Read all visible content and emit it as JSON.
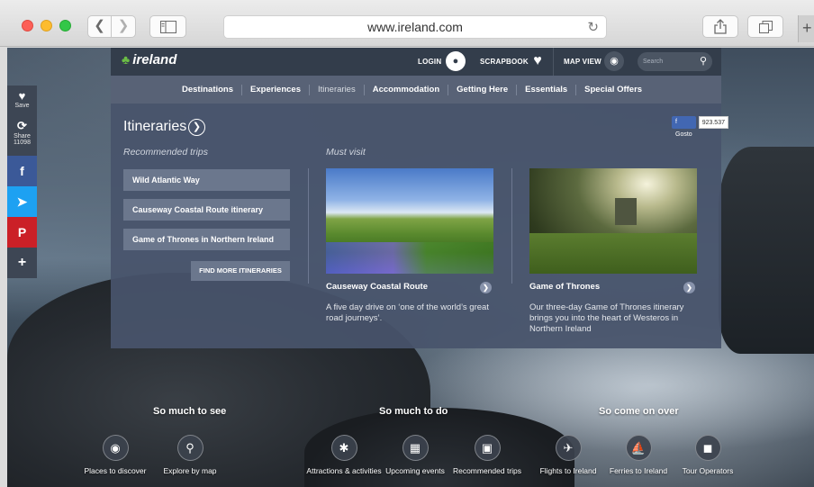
{
  "browser": {
    "url": "www.ireland.com",
    "back_icon": "chevron-left-icon",
    "forward_icon": "chevron-right-icon",
    "new_tab_glyph": "+"
  },
  "header": {
    "logo_text": "ireland",
    "login_label": "LOGIN",
    "scrapbook_label": "SCRAPBOOK",
    "map_view_label": "MAP VIEW",
    "search_placeholder": "Search"
  },
  "social": {
    "save_label": "Save",
    "share_label": "Share",
    "share_count": "11098",
    "facebook_glyph": "f",
    "twitter_glyph": "t",
    "pinterest_glyph": "P",
    "more_glyph": "+"
  },
  "nav": {
    "items": [
      {
        "label": "Destinations"
      },
      {
        "label": "Experiences"
      },
      {
        "label": "Itineraries"
      },
      {
        "label": "Accommodation"
      },
      {
        "label": "Getting Here"
      },
      {
        "label": "Essentials"
      },
      {
        "label": "Special Offers"
      }
    ]
  },
  "dropdown": {
    "title": "Itineraries",
    "facebook_like_label": "Gosto",
    "facebook_like_count": "923.537",
    "recommended_heading": "Recommended trips",
    "must_visit_heading": "Must visit",
    "trips": [
      {
        "label": "Wild Atlantic Way"
      },
      {
        "label": "Causeway Coastal Route itinerary"
      },
      {
        "label": "Game of Thrones in Northern Ireland"
      }
    ],
    "find_more_label": "FIND MORE ITINERARIES",
    "cards": [
      {
        "title": "Causeway Coastal Route",
        "description": "A five day drive on ‘one of the world’s great road journeys’."
      },
      {
        "title": "Game of Thrones",
        "description": "Our three-day Game of Thrones itinerary brings you into the heart of Westeros in Northern Ireland"
      }
    ]
  },
  "bottom": {
    "headings": [
      "So much to see",
      "So much to do",
      "So come on over"
    ],
    "items": [
      {
        "label": "Places to discover",
        "icon": "eye-icon"
      },
      {
        "label": "Explore by map",
        "icon": "map-pin-icon"
      },
      {
        "label": "Attractions & activities",
        "icon": "running-icon"
      },
      {
        "label": "Upcoming events",
        "icon": "calendar-icon"
      },
      {
        "label": "Recommended trips",
        "icon": "suitcase-icon"
      },
      {
        "label": "Flights to Ireland",
        "icon": "plane-icon"
      },
      {
        "label": "Ferries to Ireland",
        "icon": "ferry-icon"
      },
      {
        "label": "Tour Operators",
        "icon": "bus-icon"
      }
    ]
  },
  "colors": {
    "header_bg": "#333d4b",
    "nav_bg": "#586276",
    "dropdown_bg": "#48546c",
    "facebook": "#3b5998",
    "twitter": "#1da1f2",
    "pinterest": "#cb2027",
    "shamrock": "#6bbd45"
  }
}
